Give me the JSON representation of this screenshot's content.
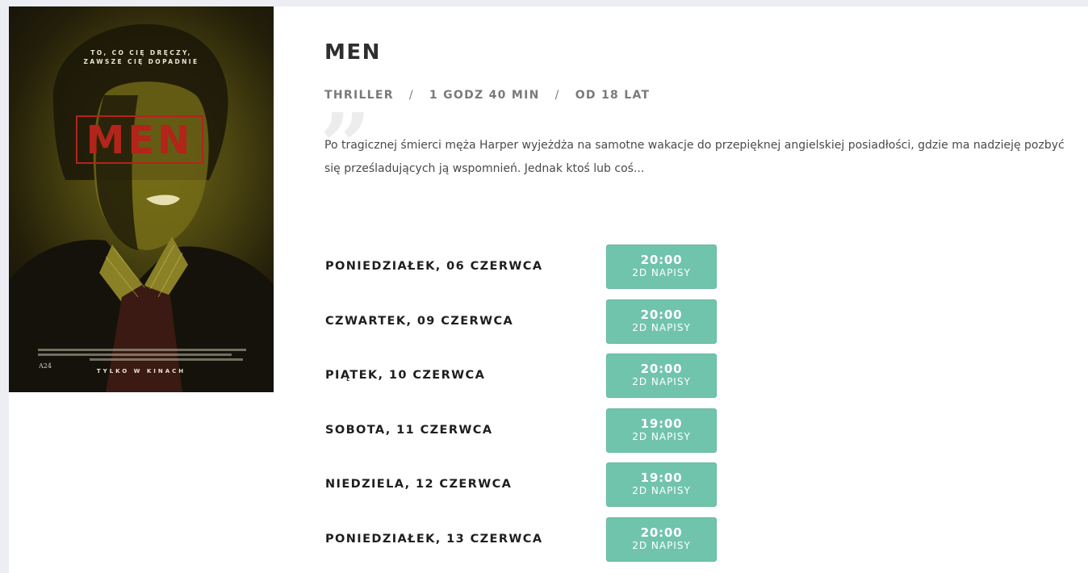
{
  "poster": {
    "tagline_line1": "TO, CO CIĘ DRĘCZY,",
    "tagline_line2": "ZAWSZE CIĘ DOPADNIE",
    "logo_text": "MEN",
    "studio": "A24",
    "bottom_text": "TYLKO W KINACH"
  },
  "movie": {
    "title": "MEN",
    "genre": "THRILLER",
    "duration": "1 GODZ 40 MIN",
    "age_rating": "OD 18 LAT",
    "separator": "/",
    "description": "Po tragicznej śmierci męża Harper wyjeżdża na samotne wakacje do przepięknej angielskiej posiadłości, gdzie ma nadzieję pozbyć się prześladujących ją wspomnień. Jednak ktoś lub coś..."
  },
  "screenings": [
    {
      "day": "PONIEDZIAŁEK, 06 CZERWCA",
      "time": "20:00",
      "format": "2D NAPISY"
    },
    {
      "day": "CZWARTEK, 09 CZERWCA",
      "time": "20:00",
      "format": "2D NAPISY"
    },
    {
      "day": "PIĄTEK, 10 CZERWCA",
      "time": "20:00",
      "format": "2D NAPISY"
    },
    {
      "day": "SOBOTA, 11 CZERWCA",
      "time": "19:00",
      "format": "2D NAPISY"
    },
    {
      "day": "NIEDZIELA, 12 CZERWCA",
      "time": "19:00",
      "format": "2D NAPISY"
    },
    {
      "day": "PONIEDZIAŁEK, 13 CZERWCA",
      "time": "20:00",
      "format": "2D NAPISY"
    }
  ],
  "colors": {
    "button_bg": "#71c4ac",
    "poster_logo": "#b3241a",
    "page_bg": "#eceef3"
  }
}
